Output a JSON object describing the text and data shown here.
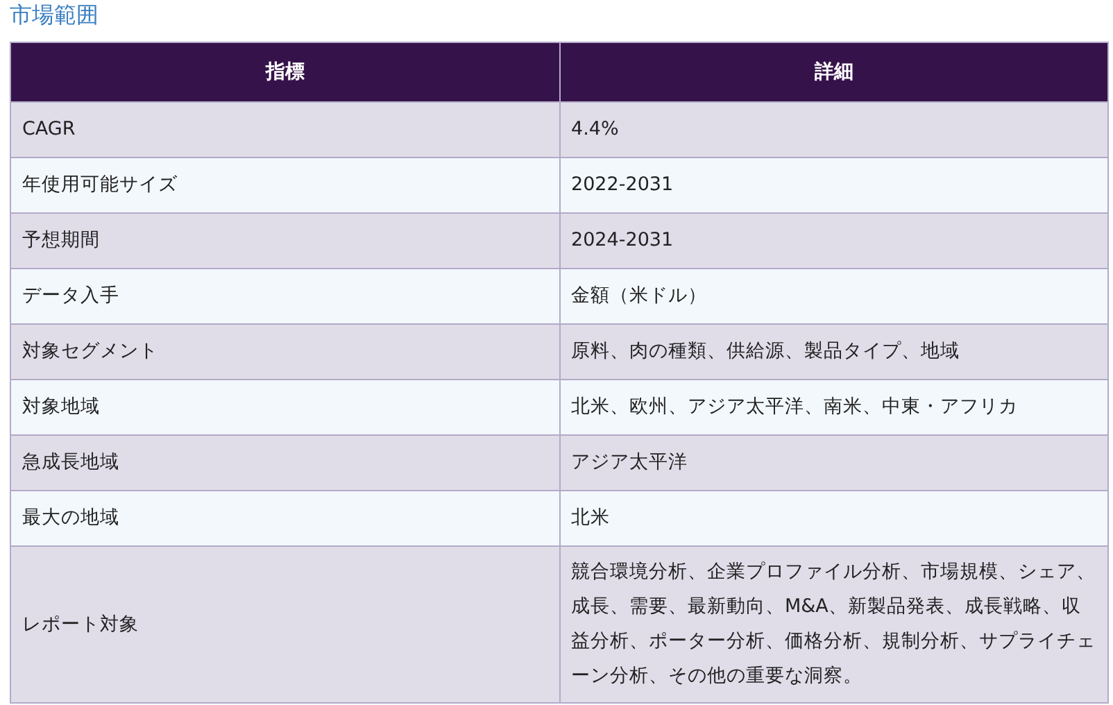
{
  "title": "市場範囲",
  "table": {
    "columns": [
      "指標",
      "詳細"
    ],
    "rows": [
      [
        "CAGR",
        "4.4%"
      ],
      [
        "年使用可能サイズ",
        "2022-2031"
      ],
      [
        "予想期間",
        "2024-2031"
      ],
      [
        "データ入手",
        "金額（米ドル）"
      ],
      [
        "対象セグメント",
        "原料、肉の種類、供給源、製品タイプ、地域"
      ],
      [
        "対象地域",
        "北米、欧州、アジア太平洋、南米、中東・アフリカ"
      ],
      [
        "急成長地域",
        "アジア太平洋"
      ],
      [
        "最大の地域",
        "北米"
      ],
      [
        "レポート対象",
        "競合環境分析、企業プロファイル分析、市場規模、シェア、成長、需要、最新動向、M&A、新製品発表、成長戦略、収益分析、ポーター分析、価格分析、規制分析、サプライチェーン分析、その他の重要な洞察。"
      ]
    ]
  }
}
